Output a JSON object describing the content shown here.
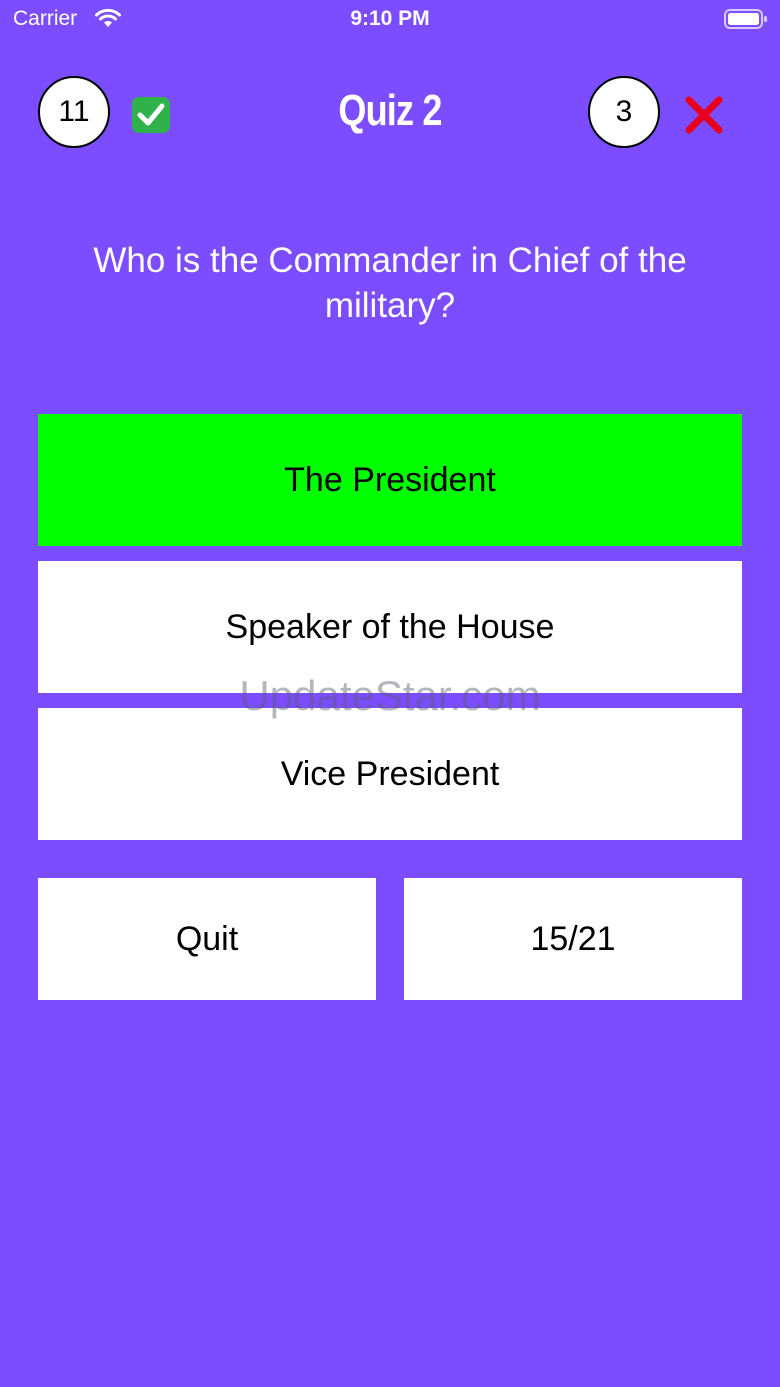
{
  "status_bar": {
    "carrier": "Carrier",
    "time": "9:10 PM",
    "wifi_icon": "wifi-icon",
    "battery_icon": "battery-icon"
  },
  "header": {
    "correct_count": "11",
    "correct_icon": "check-mark-icon",
    "title": "Quiz 2",
    "wrong_count": "3",
    "wrong_icon": "cross-mark-icon"
  },
  "question": {
    "text": "Who is the Commander in Chief of the military?"
  },
  "answers": [
    {
      "label": "The President",
      "state": "correct"
    },
    {
      "label": "Speaker of the House",
      "state": "default"
    },
    {
      "label": "Vice President",
      "state": "default"
    }
  ],
  "footer": {
    "quit_label": "Quit",
    "progress": "15/21"
  },
  "watermark": "UpdateStar.com",
  "colors": {
    "background": "#7c4dff",
    "correct_answer": "#00ff00",
    "button": "#ffffff",
    "cross": "#e8001c"
  }
}
